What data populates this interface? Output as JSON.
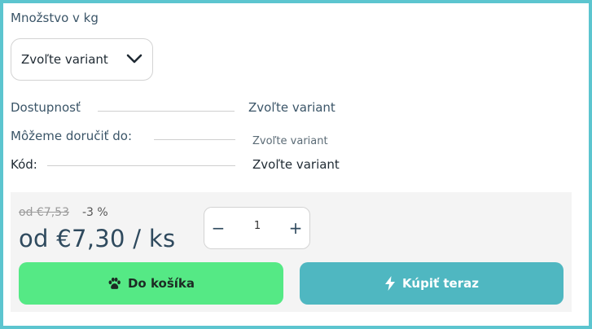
{
  "quantity_label": "Množstvo v kg",
  "variant_select": {
    "selected": "Zvoľte variant"
  },
  "info": {
    "availability_label": "Dostupnosť",
    "availability_value": "Zvoľte variant",
    "delivery_label": "Môžeme doručiť do:",
    "delivery_value": "Zvoľte variant",
    "code_label": "Kód:",
    "code_value": "Zvoľte variant"
  },
  "pricing": {
    "old_price": "od €7,53",
    "discount": "-3 %",
    "price": "od €7,30 / ks"
  },
  "stepper": {
    "minus": "−",
    "value": "1",
    "plus": "+"
  },
  "buttons": {
    "cart_label": "Do košíka",
    "cart_icon": "paw-icon",
    "buy_label": "Kúpiť teraz",
    "buy_icon": "lightning-icon"
  },
  "colors": {
    "frame_border": "#5cc5cf",
    "cart_button": "#55e985",
    "buy_button": "#4fb7c1",
    "text": "#2f4a5e"
  }
}
